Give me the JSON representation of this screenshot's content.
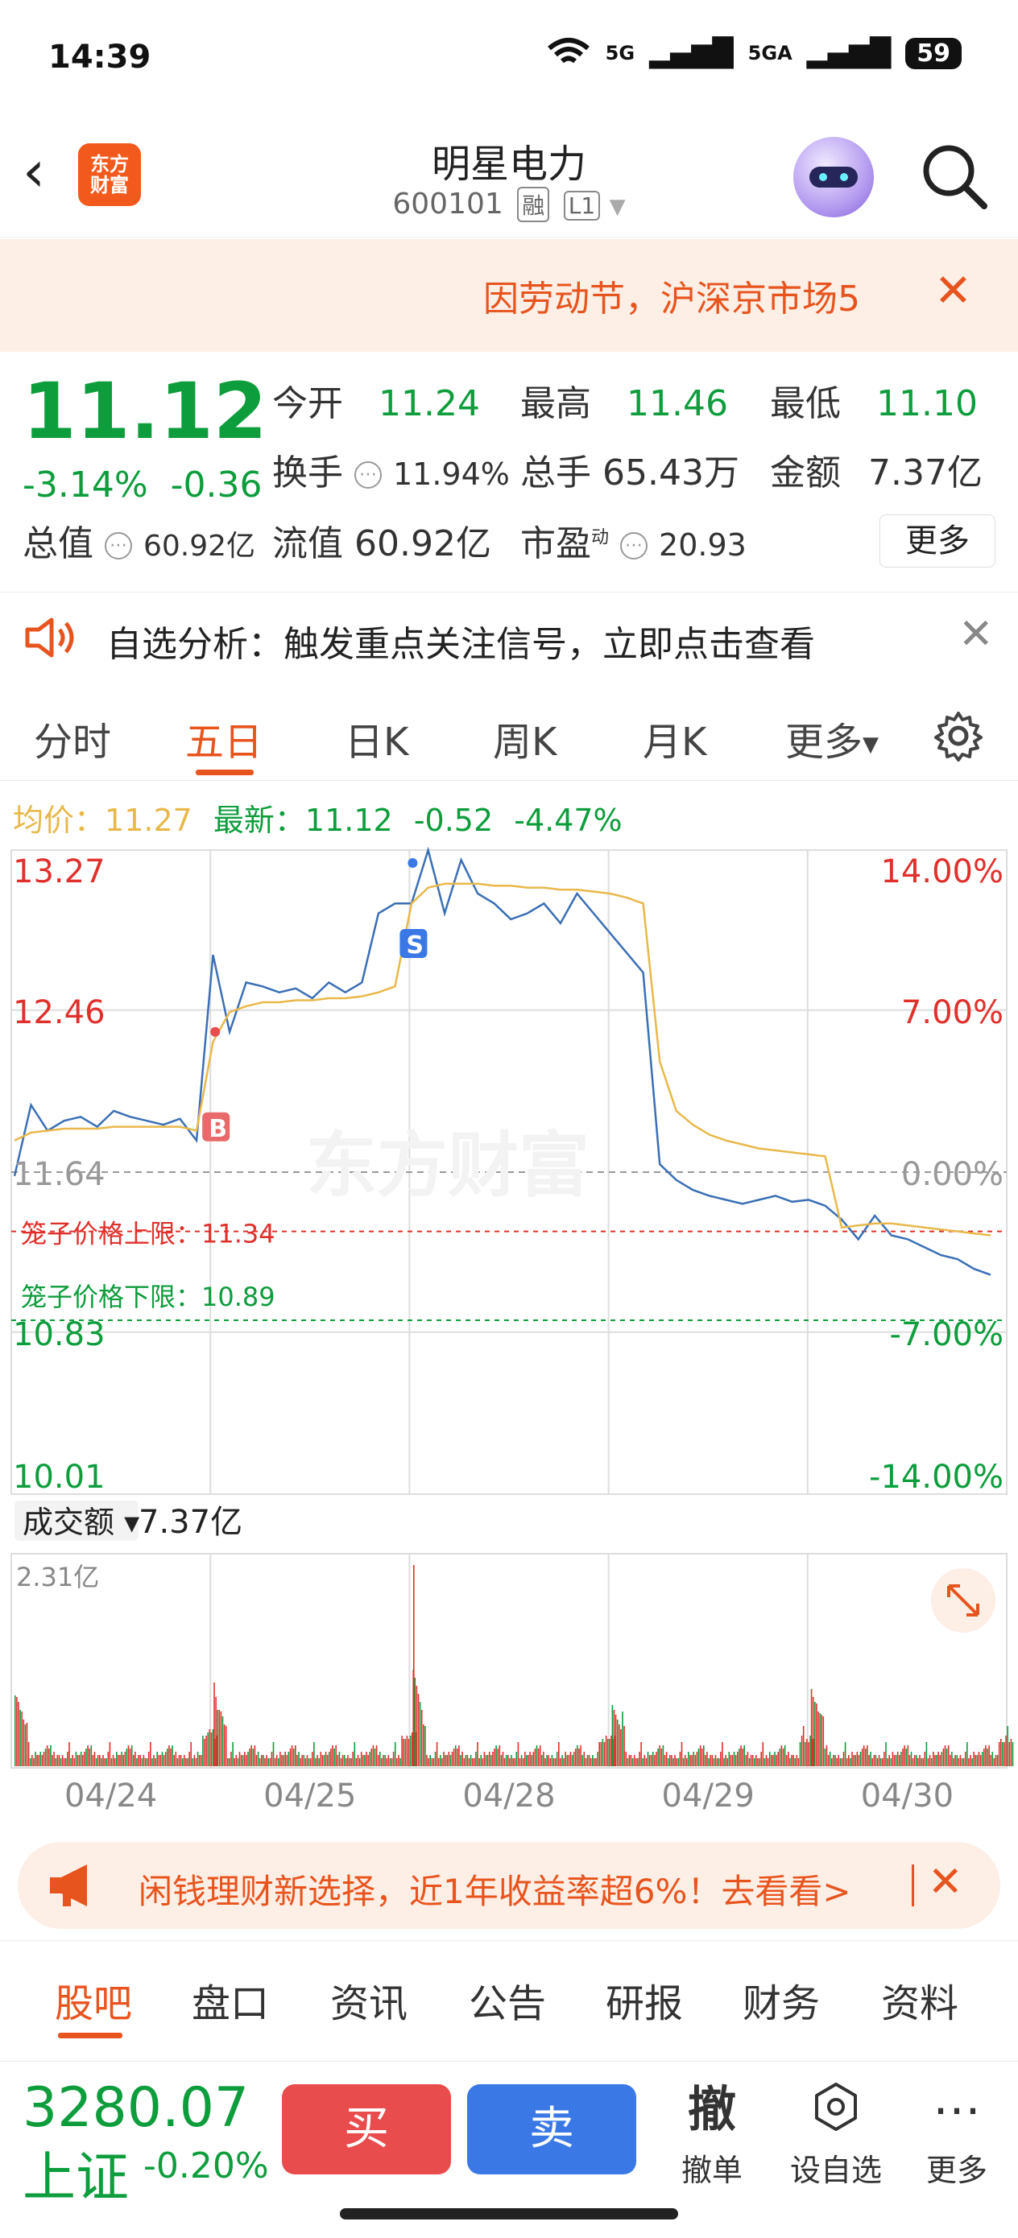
{
  "status_bar": {
    "time": "14:39",
    "network": "5G",
    "network2": "5GA",
    "battery": "59"
  },
  "header": {
    "brand": "东方财富",
    "stock_name": "明星电力",
    "stock_code": "600101",
    "tag_margin": "融",
    "tag_level": "L1"
  },
  "notice": {
    "text": "因劳动节，沪深京市场5"
  },
  "quote": {
    "price": "11.12",
    "change_pct": "-3.14%",
    "change": "-0.36",
    "items": [
      {
        "label": "今开",
        "value": "11.24"
      },
      {
        "label": "最高",
        "value": "11.46"
      },
      {
        "label": "最低",
        "value": "11.10"
      },
      {
        "label": "换手",
        "value": "11.94%"
      },
      {
        "label": "总手",
        "value": "65.43万"
      },
      {
        "label": "金额",
        "value": "7.37亿"
      },
      {
        "label": "总值",
        "value": "60.92亿"
      },
      {
        "label": "流值",
        "value": "60.92亿"
      },
      {
        "label": "市盈",
        "sup": "动",
        "value": "20.93"
      }
    ],
    "more": "更多"
  },
  "alert": {
    "text": "自选分析：触发重点关注信号，立即点击查看"
  },
  "chart_tabs": {
    "items": [
      "分时",
      "五日",
      "日K",
      "周K",
      "月K",
      "更多"
    ],
    "active": "五日"
  },
  "summary": {
    "avg_label": "均价：",
    "avg": "11.27",
    "last_label": "最新：",
    "last": "11.12",
    "chg": "-0.52",
    "chg_pct": "-4.47%"
  },
  "chart_data": {
    "type": "line",
    "price_axis": [
      "13.27",
      "12.46",
      "11.64",
      "10.83",
      "10.01"
    ],
    "pct_axis": [
      "14.00%",
      "7.00%",
      "0.00%",
      "-7.00%",
      "-14.00%"
    ],
    "ylim": [
      10.01,
      13.27
    ],
    "prev_close": 11.64,
    "x_labels": [
      "04/24",
      "04/25",
      "04/28",
      "04/29",
      "04/30"
    ],
    "cage_upper_label": "笼子价格上限：",
    "cage_upper": "11.34",
    "cage_lower_label": "笼子价格下限：",
    "cage_lower": "10.89",
    "volume_label": "成交额",
    "volume_total": "7.37亿",
    "volume_max": "2.31亿",
    "markers": [
      {
        "label": "B",
        "day": 1,
        "price": 12.35
      },
      {
        "label": "S",
        "day": 2,
        "price": 13.27
      }
    ],
    "series": [
      {
        "name": "最新",
        "color": "#3a6fb5",
        "values": [
          11.62,
          11.98,
          11.85,
          11.9,
          11.92,
          11.87,
          11.95,
          11.92,
          11.9,
          11.88,
          11.91,
          11.8,
          12.74,
          12.35,
          12.6,
          12.58,
          12.55,
          12.57,
          12.52,
          12.6,
          12.55,
          12.6,
          12.95,
          13.0,
          13.0,
          13.27,
          12.95,
          13.22,
          13.05,
          13.0,
          12.92,
          12.95,
          13.0,
          12.9,
          13.05,
          12.95,
          12.85,
          12.75,
          12.65,
          11.68,
          11.6,
          11.55,
          11.52,
          11.5,
          11.48,
          11.5,
          11.52,
          11.49,
          11.5,
          11.47,
          11.4,
          11.3,
          11.42,
          11.32,
          11.3,
          11.26,
          11.22,
          11.2,
          11.15,
          11.12
        ]
      },
      {
        "name": "均价",
        "color": "#e8b84a",
        "values": [
          11.8,
          11.84,
          11.85,
          11.86,
          11.86,
          11.86,
          11.87,
          11.87,
          11.87,
          11.87,
          11.87,
          11.85,
          12.3,
          12.45,
          12.48,
          12.5,
          12.5,
          12.51,
          12.51,
          12.52,
          12.52,
          12.53,
          12.55,
          12.58,
          13.0,
          13.08,
          13.1,
          13.1,
          13.1,
          13.09,
          13.09,
          13.08,
          13.08,
          13.07,
          13.07,
          13.06,
          13.05,
          13.03,
          13.0,
          12.2,
          11.95,
          11.88,
          11.83,
          11.8,
          11.78,
          11.76,
          11.75,
          11.74,
          11.73,
          11.72,
          11.36,
          11.37,
          11.38,
          11.38,
          11.37,
          11.36,
          11.35,
          11.34,
          11.33,
          11.32
        ]
      }
    ]
  },
  "ad": {
    "text": "闲钱理财新选择，近1年收益率超6%！去看看>"
  },
  "bottom_tabs": {
    "items": [
      "股吧",
      "盘口",
      "资讯",
      "公告",
      "研报",
      "财务",
      "资料"
    ],
    "active": "股吧"
  },
  "footer": {
    "index_value": "3280.07",
    "index_name": "上证",
    "index_change": "-0.20%",
    "buy": "买",
    "sell": "卖",
    "cancel_icon": "撤",
    "cancel": "撤单",
    "watch": "设自选",
    "more": "更多"
  },
  "colors": {
    "accent": "#e8541e",
    "up": "#e0302c",
    "down": "#0d9d3c",
    "line": "#3a6fb5",
    "avg": "#e8b84a",
    "buy": "#e84c4c",
    "sell": "#3a78e6"
  }
}
